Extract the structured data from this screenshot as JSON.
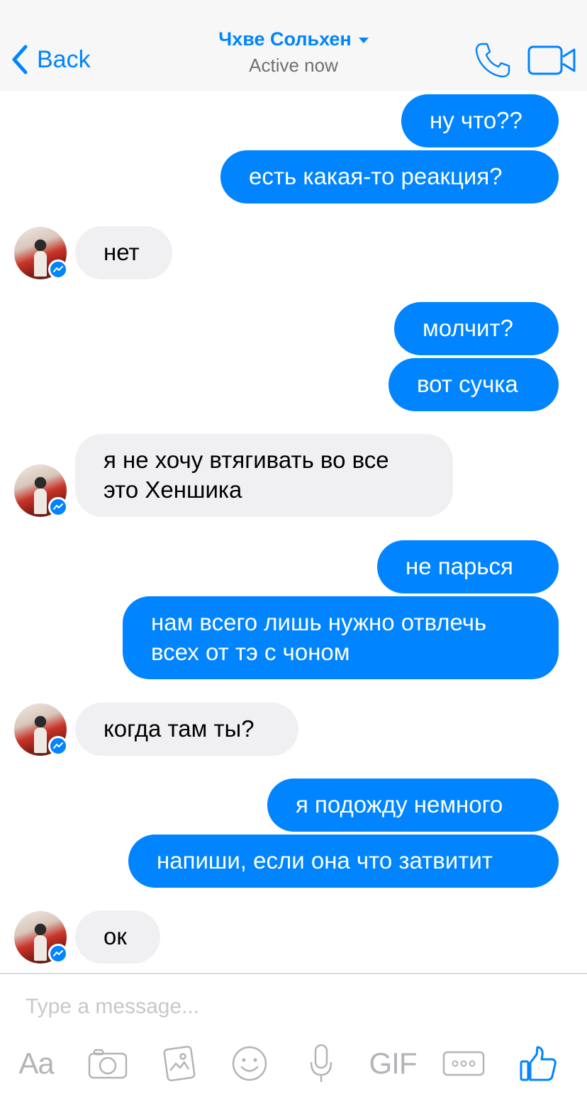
{
  "header": {
    "back_label": "Back",
    "title": "Чхве Сольхен",
    "status": "Active now"
  },
  "icons": {
    "back": "chevron-left-icon",
    "title_dropdown": "caret-down-icon",
    "call": "phone-icon",
    "video": "video-camera-icon",
    "avatar_badge": "messenger-badge-icon"
  },
  "colors": {
    "accent": "#0084ff",
    "incoming_bubble": "#f0f0f2",
    "outgoing_text": "#ffffff",
    "muted": "#b4b4b8",
    "header_bg": "#f7f7f7"
  },
  "messages": [
    {
      "from": "me",
      "lines": [
        "ну что??"
      ]
    },
    {
      "from": "me",
      "lines": [
        "есть какая-то реакция?"
      ]
    },
    {
      "from": "them",
      "lines": [
        "нет"
      ]
    },
    {
      "from": "me",
      "lines": [
        "молчит?"
      ]
    },
    {
      "from": "me",
      "lines": [
        "вот сучка"
      ]
    },
    {
      "from": "them",
      "lines": [
        "я не хочу втягивать во все",
        "это Хеншика"
      ]
    },
    {
      "from": "me",
      "lines": [
        "не парься"
      ]
    },
    {
      "from": "me",
      "lines": [
        "нам всего лишь нужно отвлечь",
        "всех от тэ с чоном"
      ]
    },
    {
      "from": "them",
      "lines": [
        "когда там ты?"
      ]
    },
    {
      "from": "me",
      "lines": [
        "я подожду немного"
      ]
    },
    {
      "from": "me",
      "lines": [
        "напиши, если она что затвитит"
      ]
    },
    {
      "from": "them",
      "lines": [
        "ок"
      ]
    }
  ],
  "composer": {
    "placeholder": "Type a message...",
    "value": ""
  },
  "toolbar": {
    "text_label": "Aa",
    "gif_label": "GIF",
    "tools": [
      "text-format-icon",
      "camera-icon",
      "gallery-icon",
      "emoji-icon",
      "microphone-icon",
      "gif-icon",
      "more-icon",
      "thumbs-up-icon"
    ]
  }
}
